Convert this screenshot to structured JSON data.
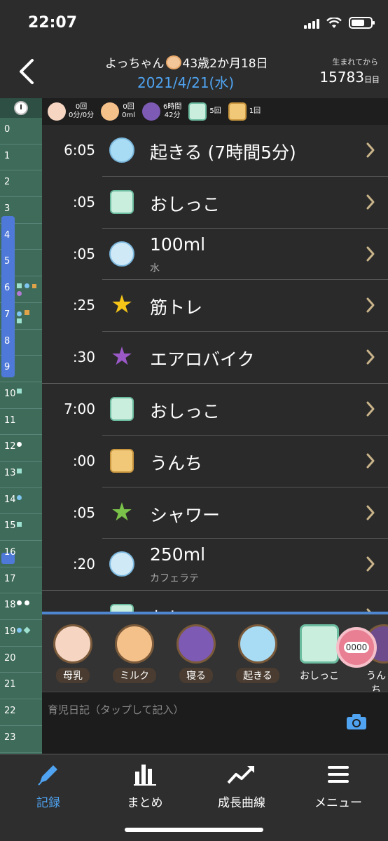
{
  "status": {
    "time": "22:07"
  },
  "header": {
    "name": "よっちゃん",
    "age": "43歳2か月18日",
    "date": "2021/4/21(水)",
    "since_label": "生まれてから",
    "since_value": "15783",
    "since_unit": "日目"
  },
  "timeline": {
    "hours": [
      "0",
      "1",
      "2",
      "3",
      "4",
      "5",
      "6",
      "7",
      "8",
      "9",
      "10",
      "11",
      "12",
      "13",
      "14",
      "15",
      "16",
      "17",
      "18",
      "19",
      "20",
      "21",
      "22",
      "23"
    ]
  },
  "summary": [
    {
      "icon": "breastfeed-icon",
      "line1": "0回",
      "line2": "0分/0分"
    },
    {
      "icon": "milk-bottle-icon",
      "line1": "0回",
      "line2": "0ml"
    },
    {
      "icon": "sleep-star-icon",
      "line1": "6時間",
      "line2": "42分"
    },
    {
      "icon": "diaper-pee-icon",
      "line1": "5回",
      "line2": ""
    },
    {
      "icon": "diaper-poo-icon",
      "line1": "1回",
      "line2": ""
    }
  ],
  "records": [
    {
      "time": "6:05",
      "icon": "wake-icon",
      "label": "起きる (7時間5分)",
      "sub": ""
    },
    {
      "time": ":05",
      "icon": "pee-icon",
      "label": "おしっこ",
      "sub": ""
    },
    {
      "time": ":05",
      "icon": "drink-icon",
      "label": "100ml",
      "sub": "水"
    },
    {
      "time": ":25",
      "icon": "yellow-star-icon",
      "label": "筋トレ",
      "sub": ""
    },
    {
      "time": ":30",
      "icon": "purple-star-icon",
      "label": "エアロバイク",
      "sub": ""
    },
    {
      "time": "7:00",
      "icon": "pee-icon",
      "label": "おしっこ",
      "sub": ""
    },
    {
      "time": ":00",
      "icon": "poo-icon",
      "label": "うんち",
      "sub": ""
    },
    {
      "time": ":05",
      "icon": "green-star-icon",
      "label": "シャワー",
      "sub": ""
    },
    {
      "time": ":20",
      "icon": "drink-icon",
      "label": "250ml",
      "sub": "カフェラテ"
    },
    {
      "time": "",
      "icon": "pee-icon",
      "label": "おしっこ",
      "sub": ""
    }
  ],
  "quick_buttons": [
    "母乳",
    "ミルク",
    "寝る",
    "起きる",
    "おしっこ",
    "うんち"
  ],
  "timer_label": "0000",
  "diary": {
    "placeholder": "育児日記（タップして記入）"
  },
  "tabs": [
    "記録",
    "まとめ",
    "成長曲線",
    "メニュー"
  ],
  "colors": {
    "accent": "#4fa3f0",
    "timeline": "#3f6b5a",
    "sleep": "#4f79d8"
  }
}
